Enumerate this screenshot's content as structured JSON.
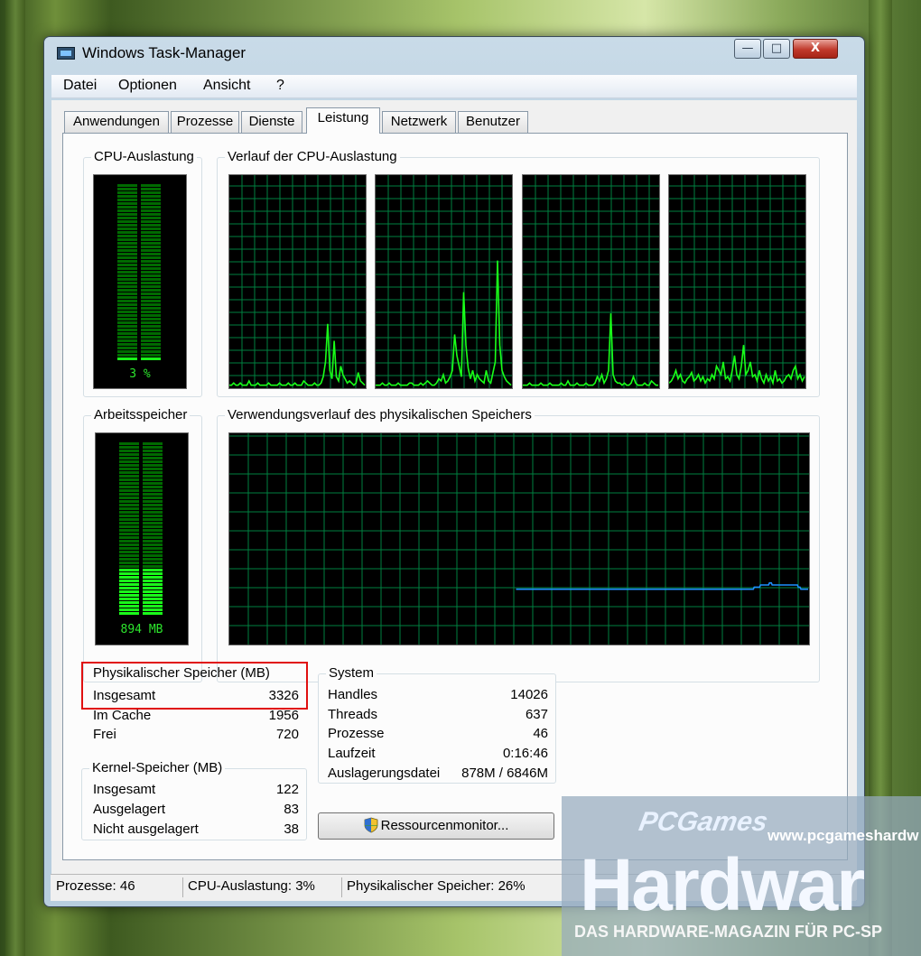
{
  "window": {
    "title": "Windows Task-Manager",
    "buttons": {
      "minimize": "—",
      "maximize": "□",
      "close": "X"
    }
  },
  "menu": [
    "Datei",
    "Optionen",
    "Ansicht",
    "?"
  ],
  "tabs": [
    "Anwendungen",
    "Prozesse",
    "Dienste",
    "Leistung",
    "Netzwerk",
    "Benutzer"
  ],
  "active_tab": "Leistung",
  "groups": {
    "cpu_usage": "CPU-Auslastung",
    "cpu_history": "Verlauf der CPU-Auslastung",
    "memory": "Arbeitsspeicher",
    "memory_history": "Verwendungsverlauf des physikalischen Speichers"
  },
  "cpu_meter": {
    "text": "3 %",
    "value_percent": 3
  },
  "memory_meter": {
    "text": "894 MB",
    "value_fraction": 0.27
  },
  "physical_memory": {
    "title": "Physikalischer Speicher (MB)",
    "rows": [
      {
        "label": "Insgesamt",
        "value": "3326"
      },
      {
        "label": "Im Cache",
        "value": "1956"
      },
      {
        "label": "Frei",
        "value": "720"
      }
    ]
  },
  "kernel_memory": {
    "title": "Kernel-Speicher (MB)",
    "rows": [
      {
        "label": "Insgesamt",
        "value": "122"
      },
      {
        "label": "Ausgelagert",
        "value": "83"
      },
      {
        "label": "Nicht ausgelagert",
        "value": "38"
      }
    ]
  },
  "system": {
    "title": "System",
    "rows": [
      {
        "label": "Handles",
        "value": "14026"
      },
      {
        "label": "Threads",
        "value": "637"
      },
      {
        "label": "Prozesse",
        "value": "46"
      },
      {
        "label": "Laufzeit",
        "value": "0:16:46"
      },
      {
        "label": "Auslagerungsdatei",
        "value": "878M / 6846M"
      }
    ]
  },
  "resource_monitor_button": "Ressourcenmonitor...",
  "status_bar": {
    "processes": "Prozesse: 46",
    "cpu": "CPU-Auslastung: 3%",
    "memory": "Physikalischer Speicher: 26%"
  },
  "chart_data": [
    {
      "type": "line",
      "series": [
        {
          "values": [
            1,
            1,
            2,
            1,
            1,
            2,
            1,
            1,
            1,
            3,
            1,
            1,
            1,
            2,
            1,
            1,
            1,
            1,
            2,
            1,
            1,
            1,
            1,
            2,
            1,
            1,
            1,
            2,
            1,
            1,
            2,
            1,
            1,
            1,
            3,
            2,
            1,
            1,
            1,
            2,
            1,
            1,
            2,
            5,
            12,
            30,
            8,
            4,
            22,
            5,
            3,
            10,
            6,
            4,
            2,
            3,
            2,
            1,
            2,
            7,
            3,
            2,
            1
          ]
        },
        {
          "values": [
            1,
            1,
            1,
            2,
            1,
            1,
            2,
            1,
            1,
            1,
            2,
            1,
            1,
            1,
            1,
            2,
            2,
            1,
            1,
            1,
            2,
            1,
            2,
            3,
            2,
            1,
            1,
            2,
            4,
            3,
            6,
            2,
            3,
            5,
            8,
            25,
            15,
            10,
            5,
            45,
            20,
            9,
            4,
            8,
            3,
            6,
            4,
            3,
            2,
            8,
            3,
            2,
            7,
            12,
            60,
            20,
            8,
            5,
            3,
            2,
            1
          ]
        },
        {
          "values": [
            1,
            1,
            1,
            2,
            1,
            1,
            1,
            1,
            2,
            1,
            1,
            1,
            2,
            1,
            1,
            1,
            1,
            2,
            1,
            1,
            3,
            1,
            1,
            1,
            2,
            1,
            1,
            1,
            2,
            1,
            1,
            1,
            2,
            5,
            3,
            6,
            2,
            4,
            8,
            35,
            6,
            3,
            2,
            2,
            1,
            2,
            1,
            1,
            2,
            5,
            2,
            1,
            1,
            1,
            2,
            1,
            1,
            3,
            2,
            1,
            1
          ]
        },
        {
          "values": [
            2,
            3,
            5,
            8,
            4,
            6,
            3,
            2,
            4,
            5,
            7,
            3,
            4,
            6,
            3,
            5,
            2,
            4,
            3,
            6,
            4,
            10,
            8,
            6,
            12,
            4,
            5,
            3,
            8,
            15,
            6,
            4,
            10,
            20,
            6,
            8,
            12,
            5,
            6,
            3,
            8,
            4,
            2,
            6,
            3,
            5,
            2,
            8,
            3,
            4,
            2,
            3,
            5,
            6,
            4,
            8,
            10,
            4,
            6,
            3,
            5
          ]
        }
      ],
      "ylim": [
        0,
        100
      ]
    },
    {
      "type": "line",
      "series": [
        {
          "values": [
            null,
            null,
            null,
            null,
            null,
            null,
            null,
            null,
            null,
            null,
            null,
            null,
            null,
            null,
            null,
            null,
            null,
            null,
            null,
            null,
            null,
            null,
            null,
            null,
            null,
            null,
            null,
            null,
            null,
            null,
            null,
            null,
            null,
            null,
            null,
            null,
            null,
            null,
            null,
            null,
            null,
            null,
            null,
            null,
            null,
            null,
            null,
            null,
            null,
            null,
            null,
            null,
            null,
            null,
            null,
            null,
            null,
            null,
            null,
            null,
            null,
            null,
            null,
            null,
            null,
            null,
            null,
            null,
            null,
            null,
            null,
            null,
            null,
            null,
            null,
            null,
            null,
            null,
            null,
            null,
            null,
            null,
            null,
            null,
            null,
            null,
            null,
            null,
            null,
            null,
            null,
            null,
            null,
            null,
            null,
            null,
            null,
            null,
            null,
            null,
            null,
            null,
            null,
            null,
            null,
            null,
            null,
            null,
            null,
            null,
            null,
            null,
            null,
            null,
            null,
            null,
            null,
            null,
            null,
            null,
            null,
            null,
            null,
            null,
            null,
            null,
            null,
            null,
            null,
            null,
            null,
            null,
            null,
            null,
            null,
            null,
            null,
            null,
            null,
            null,
            null,
            null,
            null,
            null,
            null,
            null,
            null,
            null,
            null,
            null,
            null,
            null,
            null,
            null,
            null,
            null,
            null,
            null,
            null,
            null,
            null,
            null,
            null,
            null,
            null,
            null,
            null,
            null,
            null,
            null,
            null,
            null,
            null,
            null,
            null,
            null,
            null,
            null,
            null,
            null,
            null,
            null,
            null,
            null,
            null,
            null,
            null,
            null,
            null,
            null,
            null,
            null,
            null,
            null,
            null,
            null,
            null,
            null,
            null,
            null,
            null,
            null,
            null,
            null,
            null,
            null,
            null,
            null,
            null,
            null,
            null,
            null,
            null,
            null,
            null,
            null,
            null,
            null,
            null,
            null,
            null,
            null,
            null,
            null,
            null,
            null,
            null,
            null,
            null,
            null,
            null,
            null,
            null,
            null,
            null,
            null,
            null,
            null,
            null,
            null,
            null,
            null,
            null,
            null,
            null,
            null,
            null,
            null,
            null,
            null,
            null,
            null,
            null,
            null,
            null,
            null,
            null,
            null,
            null,
            null,
            null,
            null,
            null,
            null,
            null,
            null,
            null,
            null,
            null,
            null,
            null,
            null,
            null,
            null,
            null,
            null,
            null,
            null,
            null,
            null,
            null,
            null,
            null,
            null,
            null,
            null,
            null,
            null,
            null,
            null,
            null,
            null,
            null,
            null,
            null,
            null,
            null,
            null,
            null,
            null,
            null,
            null,
            null,
            null,
            null,
            null,
            null,
            null,
            null,
            null,
            null,
            null,
            null,
            null,
            null,
            null,
            null,
            null,
            null,
            26,
            26,
            26,
            26,
            26,
            26,
            26,
            26,
            26,
            26,
            26,
            26,
            26,
            26,
            26,
            26,
            26,
            26,
            26,
            26,
            26,
            26,
            26,
            26,
            26,
            26,
            26,
            26,
            26,
            26,
            26,
            26,
            26,
            26,
            26,
            26,
            26,
            26,
            26,
            26,
            26,
            26,
            26,
            26,
            26,
            26,
            26,
            26,
            26,
            26,
            26,
            26,
            26,
            26,
            26,
            26,
            26,
            26,
            26,
            26,
            26,
            26,
            26,
            26,
            26,
            26,
            26,
            26,
            26,
            26,
            26,
            26,
            26,
            26,
            26,
            26,
            26,
            26,
            26,
            26,
            26,
            26,
            26,
            26,
            26,
            26,
            26,
            26,
            26,
            26,
            26,
            26,
            26,
            26,
            26,
            26,
            26,
            26,
            26,
            26,
            26,
            26,
            26,
            26,
            26,
            26,
            26,
            26,
            26,
            26,
            26,
            26,
            26,
            26,
            26,
            26,
            26,
            26,
            26,
            26,
            26,
            26,
            26,
            26,
            26,
            26,
            26,
            26,
            26,
            26,
            26,
            26,
            26,
            26,
            26,
            26,
            26,
            26,
            26,
            26,
            26,
            26,
            26,
            26,
            26,
            26,
            26,
            26,
            26,
            26,
            26,
            26,
            26,
            26,
            26,
            26,
            26,
            26,
            26,
            26,
            26,
            26,
            26,
            26,
            26,
            26,
            26,
            26,
            26,
            26,
            26,
            26,
            26,
            26,
            26,
            26,
            26,
            26,
            26,
            26,
            26,
            26,
            26,
            26,
            26,
            26,
            26,
            26,
            26,
            26,
            26,
            26,
            26,
            26,
            26,
            26,
            26,
            26,
            26,
            26,
            26,
            26,
            26,
            26,
            26,
            26,
            26,
            26,
            26,
            26,
            26,
            26,
            26,
            26,
            26,
            26,
            26,
            26,
            26,
            26,
            26,
            26,
            26,
            26,
            26,
            26,
            26,
            26,
            26,
            26,
            26,
            26,
            26,
            26,
            26,
            26,
            26,
            26,
            26,
            26,
            26,
            26,
            26,
            26,
            26,
            26,
            26,
            26,
            26,
            26,
            26,
            26,
            26,
            26,
            26,
            26,
            26,
            26,
            26,
            26,
            26,
            26,
            26,
            26,
            26,
            27,
            27,
            27,
            27,
            27,
            27,
            27,
            28,
            28,
            28,
            28,
            28,
            28,
            28,
            28,
            28,
            28,
            29,
            29,
            29,
            28,
            28,
            28,
            28,
            28,
            28,
            28,
            28,
            28,
            28,
            28,
            28,
            28,
            28,
            28,
            28,
            28,
            28,
            28,
            28,
            28,
            28,
            28,
            28,
            28,
            28,
            28,
            28,
            28,
            27,
            27,
            27,
            26,
            26,
            26,
            26,
            26,
            26,
            26,
            26,
            26
          ]
        }
      ],
      "ylim": [
        0,
        100
      ]
    }
  ]
}
